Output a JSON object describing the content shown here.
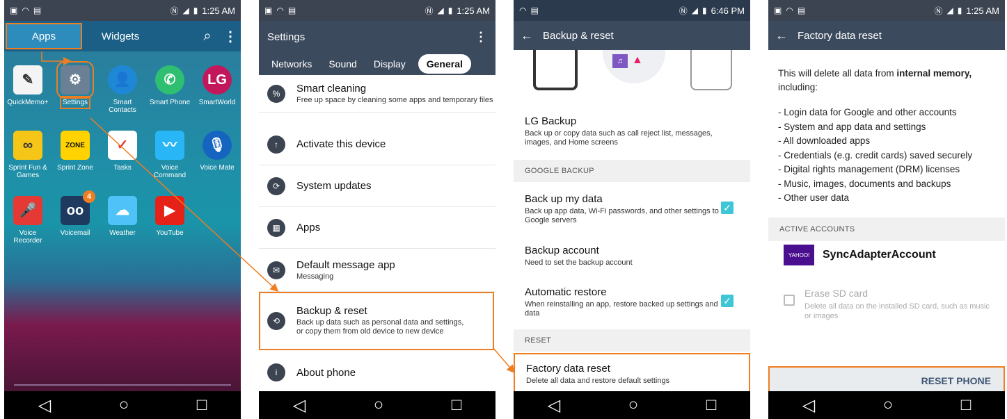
{
  "colors": {
    "accent": "#ef7d22",
    "appbar": "#3c4a5e",
    "check": "#3ec6d6"
  },
  "panel1": {
    "status": {
      "time": "1:25 AM"
    },
    "tabs": {
      "apps": "Apps",
      "widgets": "Widgets"
    },
    "apps": [
      {
        "label": "QuickMemo+",
        "icon": "quickmemo-icon",
        "glyph": "✎",
        "bg": "#f4f4f4",
        "fg": "#333"
      },
      {
        "label": "Settings",
        "icon": "gear-icon",
        "glyph": "⚙",
        "bg": "#6b7f95",
        "fg": "#fff"
      },
      {
        "label": "Smart Contacts",
        "icon": "contacts-icon",
        "glyph": "👤",
        "bg": "#1e88d6",
        "fg": "#fff"
      },
      {
        "label": "Smart Phone",
        "icon": "phone-icon",
        "glyph": "✆",
        "bg": "#2fbf71",
        "fg": "#fff"
      },
      {
        "label": "SmartWorld",
        "icon": "lg-icon",
        "glyph": "LG",
        "bg": "#c2185b",
        "fg": "#fff"
      },
      {
        "label": "Sprint Fun & Games",
        "icon": "games-icon",
        "glyph": "∞",
        "bg": "#f5c518",
        "fg": "#333"
      },
      {
        "label": "Sprint Zone",
        "icon": "zone-icon",
        "glyph": "ZONE",
        "bg": "#ffd200",
        "fg": "#111"
      },
      {
        "label": "Tasks",
        "icon": "tasks-icon",
        "glyph": "✓",
        "bg": "#ffffff",
        "fg": "#e53935"
      },
      {
        "label": "Voice Command",
        "icon": "waveform-icon",
        "glyph": "〰",
        "bg": "#29b6f6",
        "fg": "#fff"
      },
      {
        "label": "Voice Mate",
        "icon": "mic-icon",
        "glyph": "🎙",
        "bg": "#1565c0",
        "fg": "#fff"
      },
      {
        "label": "Voice Recorder",
        "icon": "recorder-icon",
        "glyph": "🎤",
        "bg": "#e53935",
        "fg": "#fff"
      },
      {
        "label": "Voicemail",
        "icon": "voicemail-icon",
        "glyph": "oo",
        "bg": "#1e3a5f",
        "fg": "#fff",
        "badge": "4"
      },
      {
        "label": "Weather",
        "icon": "weather-icon",
        "glyph": "☁",
        "bg": "#4fc3f7",
        "fg": "#fff"
      },
      {
        "label": "YouTube",
        "icon": "youtube-icon",
        "glyph": "▶",
        "bg": "#e62117",
        "fg": "#fff"
      }
    ]
  },
  "panel2": {
    "status": {
      "time": "1:25 AM"
    },
    "title": "Settings",
    "tabs": [
      "Networks",
      "Sound",
      "Display",
      "General"
    ],
    "items": [
      {
        "title": "Smart cleaning",
        "sub": "Free up space by cleaning some apps and temporary files"
      },
      {
        "title": "Activate this device",
        "sub": ""
      },
      {
        "title": "System updates",
        "sub": ""
      },
      {
        "title": "Apps",
        "sub": ""
      },
      {
        "title": "Default message app",
        "sub": "Messaging"
      },
      {
        "title": "Backup & reset",
        "sub": "Back up data such as personal data and settings, or copy them from old device to new device"
      },
      {
        "title": "About phone",
        "sub": ""
      }
    ]
  },
  "panel3": {
    "status": {
      "time": "6:46 PM"
    },
    "title": "Backup & reset",
    "lg_backup": {
      "title": "LG Backup",
      "sub": "Back up or copy data such as call reject list, messages, images, and Home screens"
    },
    "section_google": "GOOGLE BACKUP",
    "backup_my_data": {
      "title": "Back up my data",
      "sub": "Back up app data, Wi-Fi passwords, and other settings to Google servers",
      "checked": true
    },
    "backup_account": {
      "title": "Backup account",
      "sub": "Need to set the backup account"
    },
    "auto_restore": {
      "title": "Automatic restore",
      "sub": "When reinstalling an app, restore backed up settings and data",
      "checked": true
    },
    "section_reset": "RESET",
    "factory": {
      "title": "Factory data reset",
      "sub": "Delete all data and restore default settings"
    }
  },
  "panel4": {
    "status": {
      "time": "1:25 AM"
    },
    "title": "Factory data reset",
    "intro_pre": "This will delete all data from ",
    "intro_bold": "internal memory,",
    "intro_post": "including:",
    "list": [
      "- Login data for Google and other accounts",
      "- System and app data and settings",
      "- All downloaded apps",
      "- Credentials (e.g. credit cards) saved securely",
      "- Digital rights management (DRM) licenses",
      "- Music, images, documents and backups",
      "- Other user data"
    ],
    "section_accounts": "ACTIVE ACCOUNTS",
    "account_logo": "YAHOO!",
    "account_name": "SyncAdapterAccount",
    "erase_title": "Erase SD card",
    "erase_sub": "Delete all data on the installed SD card, such as music or images",
    "reset_button": "RESET PHONE"
  }
}
